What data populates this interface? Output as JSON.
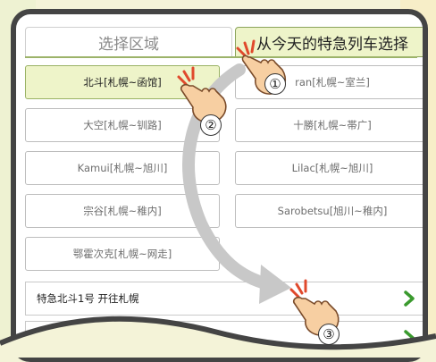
{
  "tabs": {
    "region": "选择区域",
    "train": "从今天的特急列车选择"
  },
  "trains": [
    {
      "label": "北斗[札幌~函馆]",
      "selected": true
    },
    {
      "label": "ran[札幌~室兰]",
      "selected": false
    },
    {
      "label": "大空[札幌~钏路]",
      "selected": false
    },
    {
      "label": "十勝[札幌~帯广]",
      "selected": false
    },
    {
      "label": "Kamui[札幌~旭川]",
      "selected": false
    },
    {
      "label": "Lilac[札幌~旭川]",
      "selected": false
    },
    {
      "label": "宗谷[札幌~稚内]",
      "selected": false
    },
    {
      "label": "Sarobetsu[旭川~稚内]",
      "selected": false
    },
    {
      "label": "鄂霍次克[札幌~网走]",
      "selected": false
    }
  ],
  "list": [
    {
      "label": "特急北斗1号 开往札幌"
    },
    {
      "label": ""
    }
  ],
  "steps": [
    "①",
    "②",
    "③"
  ],
  "colors": {
    "accent": "#eef4c9",
    "chevron": "#3a9a2e",
    "hand": "#f7cfa2",
    "arrow": "#c8c8c8"
  },
  "icons": [
    "chevron-right-icon",
    "pointing-hand-icon"
  ]
}
